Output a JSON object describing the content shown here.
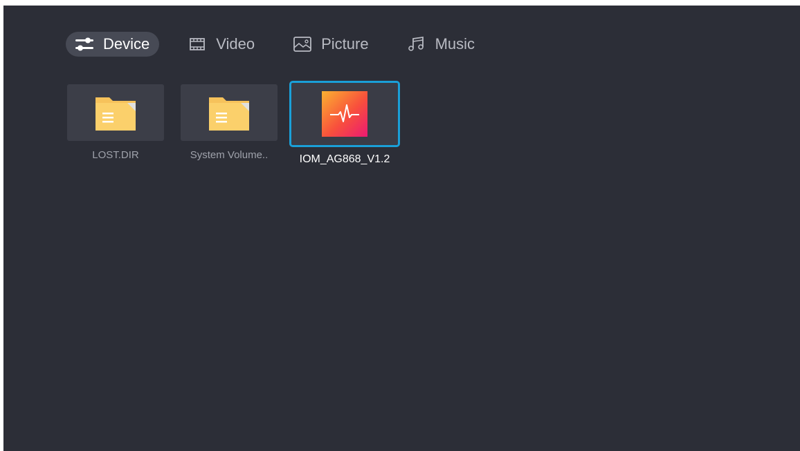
{
  "tabs": [
    {
      "label": "Device",
      "icon": "sliders-icon",
      "active": true
    },
    {
      "label": "Video",
      "icon": "film-icon",
      "active": false
    },
    {
      "label": "Picture",
      "icon": "image-icon",
      "active": false
    },
    {
      "label": "Music",
      "icon": "music-note-icon",
      "active": false
    }
  ],
  "files": [
    {
      "name": "LOST.DIR",
      "type": "folder",
      "icon": "folder-icon"
    },
    {
      "name": "System Volume..",
      "type": "folder",
      "icon": "folder-icon"
    },
    {
      "name": "IOM_AG868_V1.2",
      "type": "audio",
      "icon": "audio-wave-icon",
      "focused": true
    }
  ],
  "colors": {
    "background": "#2c2e37",
    "tab_active_bg": "#474a55",
    "card_bg": "#3c3e48",
    "focus_border": "#1aa0d8",
    "folder": "#f6c25b"
  }
}
